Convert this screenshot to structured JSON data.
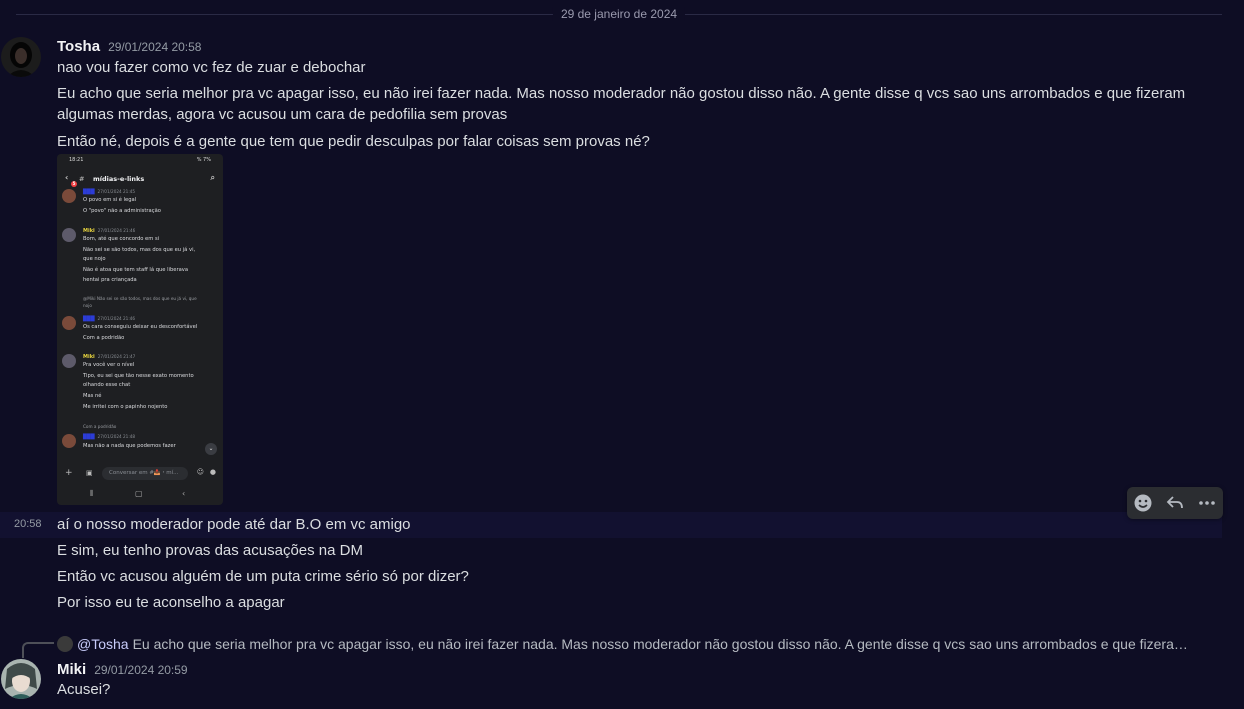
{
  "date_divider": "29 de janeiro de 2024",
  "msg1": {
    "username": "Tosha",
    "timestamp": "29/01/2024 20:58",
    "lines": [
      "nao vou fazer como vc fez de zuar e debochar",
      "Eu acho que seria melhor pra vc apagar isso, eu não irei fazer nada. Mas nosso moderador não gostou disso não. A gente disse q vcs sao uns arrombados e que fizeram",
      "algumas merdas, agora vc acusou um cara de pedofilia sem provas",
      "Então né, depois é a gente que tem que pedir desculpas por falar coisas sem provas né?"
    ]
  },
  "attachment": {
    "status_time": "18:21",
    "status_right": "%  7%",
    "channel_name": "mídias-e-links",
    "badge": "5",
    "messages": [
      {
        "user": "",
        "time": "27/01/2024 21:45",
        "lines": [
          "O povo em si é legal",
          "O \"povo\" não a administração"
        ]
      },
      {
        "user": "Miki",
        "time": "27/01/2024 21:46",
        "lines": [
          "Bom,  até que concordo em si",
          "Não sei se são todos, mas dos que eu já vi,",
          "que nojo",
          "Não é atoa que tem staff lá que liberava",
          "hentai pra criançada"
        ]
      },
      {
        "reply": "@Miki Não sei se são todos, mas dos que eu já vi, que",
        "reply2": "nojo",
        "user": "",
        "time": "27/01/2024 21:46",
        "lines": [
          "Os cara conseguiu deixar eu desconfortável",
          "Com a podridão"
        ]
      },
      {
        "user": "Miki",
        "time": "27/01/2024 21:47",
        "lines": [
          "Pra você ver o nível",
          "Tipo, eu sei que tão nesse exato momento",
          "olhando esse chat",
          "Mas né",
          "Me irritei com o papinho nojento"
        ]
      },
      {
        "reply": "Com a podridão",
        "user": "",
        "time": "27/01/2024 21:48",
        "lines": [
          "Mas não a nada que podemos fazer"
        ]
      }
    ],
    "input_placeholder": "Conversar em #📥・mí..."
  },
  "toolbar": {
    "react_icon": "emoji-icon",
    "reply_icon": "reply-icon",
    "more_icon": "more-icon"
  },
  "msg1_cont": {
    "time": "20:58",
    "lines": [
      "aí o nosso moderador pode até dar B.O em vc amigo",
      "E sim, eu tenho provas das acusações na DM",
      "Então vc acusou alguém de um puta crime sério só por dizer?",
      "Por isso eu te aconselho a apagar"
    ]
  },
  "msg2": {
    "reply_mention": "@Tosha",
    "reply_text": "Eu acho que seria melhor pra vc apagar isso, eu não irei fazer nada. Mas nosso moderador não gostou disso não. A gente disse q vcs sao uns arrombados e que fizeram algumas m...",
    "username": "Miki",
    "timestamp": "29/01/2024 20:59",
    "lines": [
      "Acusei?"
    ]
  }
}
